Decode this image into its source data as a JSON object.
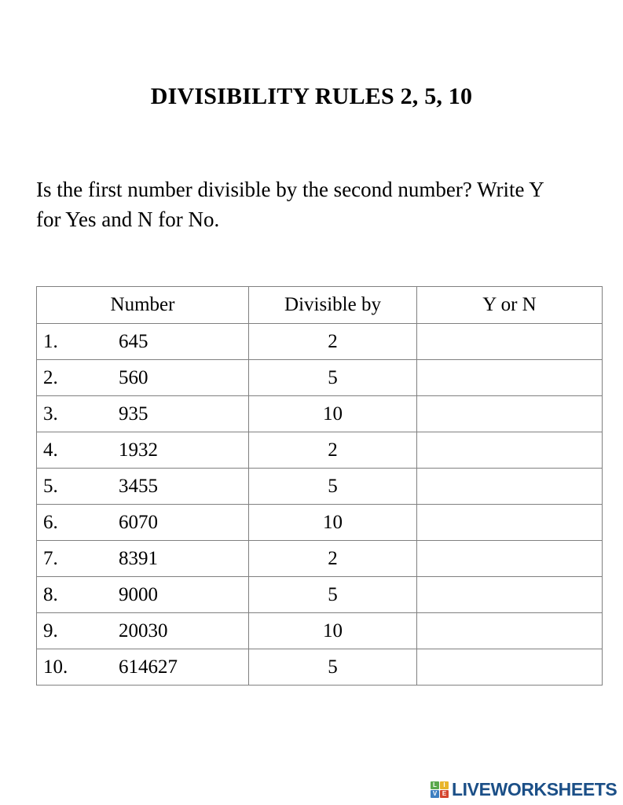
{
  "document": {
    "title": "DIVISIBILITY RULES 2, 5, 10",
    "instructions": "Is the first number divisible by the second number? Write Y for Yes and N for No."
  },
  "table": {
    "headers": {
      "number": "Number",
      "divisible_by": "Divisible by",
      "answer": "Y or N"
    },
    "rows": [
      {
        "index": "1.",
        "number": "645",
        "divisor": "2",
        "answer": ""
      },
      {
        "index": "2.",
        "number": "560",
        "divisor": "5",
        "answer": ""
      },
      {
        "index": "3.",
        "number": "935",
        "divisor": "10",
        "answer": ""
      },
      {
        "index": "4.",
        "number": "1932",
        "divisor": "2",
        "answer": ""
      },
      {
        "index": "5.",
        "number": "3455",
        "divisor": "5",
        "answer": ""
      },
      {
        "index": "6.",
        "number": "6070",
        "divisor": "10",
        "answer": ""
      },
      {
        "index": "7.",
        "number": "8391",
        "divisor": "2",
        "answer": ""
      },
      {
        "index": "8.",
        "number": "9000",
        "divisor": "5",
        "answer": ""
      },
      {
        "index": "9.",
        "number": "20030",
        "divisor": "10",
        "answer": ""
      },
      {
        "index": "10.",
        "number": "614627",
        "divisor": "5",
        "answer": ""
      }
    ]
  },
  "logo": {
    "tiles": [
      {
        "letter": "L",
        "color": "#5aa84b"
      },
      {
        "letter": "I",
        "color": "#e8b52a"
      },
      {
        "letter": "V",
        "color": "#3d7fc1"
      },
      {
        "letter": "E",
        "color": "#d4452e"
      }
    ],
    "text": "LIVEWORKSHEETS",
    "text_color": "#1b4f87"
  },
  "colors": {
    "page_background": "#ffffff",
    "text": "#000000",
    "table_border": "#808080"
  }
}
